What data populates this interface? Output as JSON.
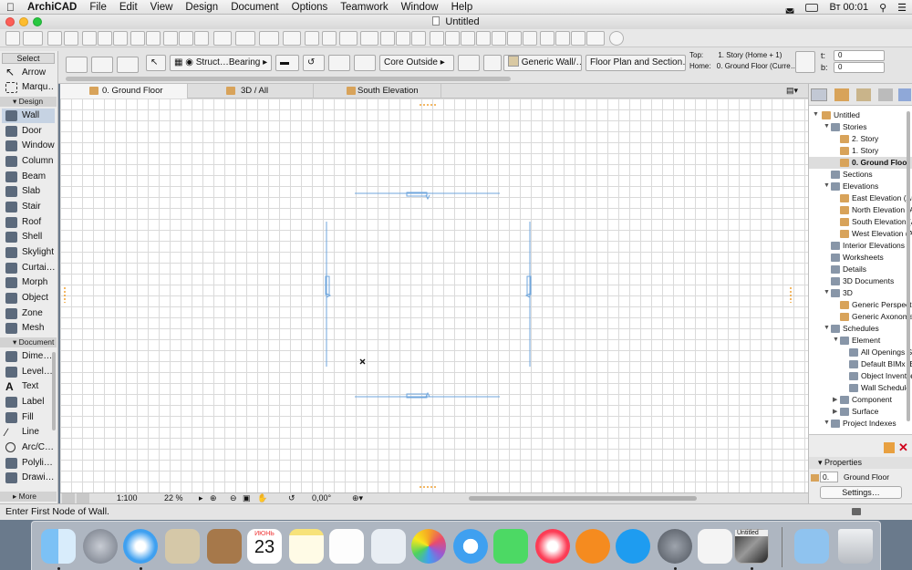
{
  "menubar": {
    "apple": "",
    "app_name": "ArchiCAD",
    "items": [
      "File",
      "Edit",
      "View",
      "Design",
      "Document",
      "Options",
      "Teamwork",
      "Window",
      "Help"
    ],
    "clock": "Вт 00:01"
  },
  "window": {
    "title": "Untitled"
  },
  "infobox": {
    "structure": "Struct…Bearing",
    "core": "Core Outside",
    "material": "Generic Wall/…",
    "floorplan": "Floor Plan and Section…",
    "top_label": "Top:",
    "top_value": "1. Story (Home + 1)",
    "home_label": "Home:",
    "home_value": "0. Ground Floor (Curre…",
    "t_label": "t:",
    "t_value": "0",
    "b_label": "b:",
    "b_value": "0"
  },
  "tabs": [
    {
      "label": "0. Ground Floor"
    },
    {
      "label": "3D / All"
    },
    {
      "label": "South Elevation"
    }
  ],
  "toolbox": {
    "select_label": "Select",
    "arrow": "Arrow",
    "marquee": "Marqu…",
    "design_group": "Design",
    "design_tools": [
      "Wall",
      "Door",
      "Window",
      "Column",
      "Beam",
      "Slab",
      "Stair",
      "Roof",
      "Shell",
      "Skylight",
      "Curtai…",
      "Morph",
      "Object",
      "Zone",
      "Mesh"
    ],
    "document_group": "Document",
    "document_tools": [
      "Dime…",
      "Level…",
      "Text",
      "Label",
      "Fill",
      "Line",
      "Arc/C…",
      "Polyli…",
      "Drawi…"
    ],
    "more_label": "More"
  },
  "canvas_status": {
    "scale": "1:100",
    "zoom": "22 %",
    "angle": "0,00°"
  },
  "status_text": "Enter First Node of Wall.",
  "navigator": {
    "root": "Untitled",
    "items": [
      {
        "label": "Stories"
      },
      {
        "label": "2. Story"
      },
      {
        "label": "1. Story"
      },
      {
        "label": "0. Ground Floor"
      },
      {
        "label": "Sections"
      },
      {
        "label": "Elevations"
      },
      {
        "label": "East Elevation (Au"
      },
      {
        "label": "North Elevation (A"
      },
      {
        "label": "South Elevation (A"
      },
      {
        "label": "West Elevation (Au"
      },
      {
        "label": "Interior Elevations"
      },
      {
        "label": "Worksheets"
      },
      {
        "label": "Details"
      },
      {
        "label": "3D Documents"
      },
      {
        "label": "3D"
      },
      {
        "label": "Generic Perspecti"
      },
      {
        "label": "Generic Axonome"
      },
      {
        "label": "Schedules"
      },
      {
        "label": "Element"
      },
      {
        "label": "All Openings Sc"
      },
      {
        "label": "Default BIMx IE"
      },
      {
        "label": "Object Inventor"
      },
      {
        "label": "Wall Schedule"
      },
      {
        "label": "Component"
      },
      {
        "label": "Surface"
      },
      {
        "label": "Project Indexes"
      }
    ]
  },
  "properties": {
    "header": "Properties",
    "id": "0.",
    "name": "Ground Floor",
    "settings": "Settings…"
  },
  "dock": {
    "calendar_month": "ИЮНЬ",
    "calendar_day": "23",
    "untitled_thumb": "Untitled",
    "apps": [
      "finder-icon",
      "launchpad-icon",
      "safari-icon",
      "mail-icon",
      "contacts-icon",
      "calendar-icon",
      "notes-icon",
      "reminders-icon",
      "preview-icon",
      "photos-icon",
      "messages-icon",
      "facetime-icon",
      "itunes-icon",
      "ibooks-icon",
      "appstore-icon",
      "system-preferences-icon",
      "textedit-icon",
      "archicad-icon",
      "downloads-icon",
      "trash-icon"
    ]
  },
  "colors": {
    "selection": "#c6d3e3",
    "wall_line": "#6fa6dd",
    "marker": "#f0a030"
  }
}
